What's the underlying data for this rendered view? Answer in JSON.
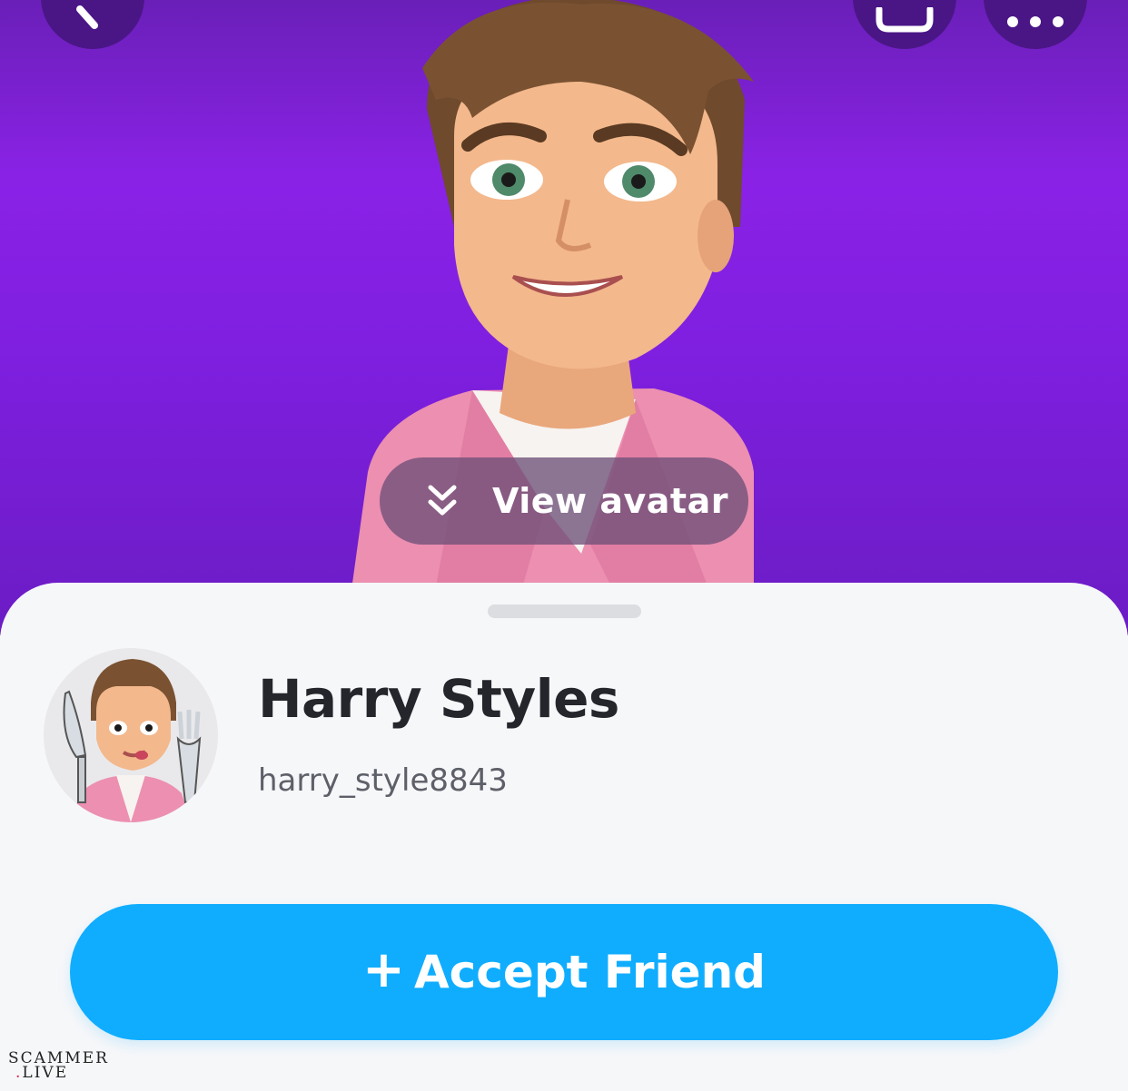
{
  "hero": {
    "view_avatar_label": "View avatar"
  },
  "profile": {
    "display_name": "Harry Styles",
    "username": "harry_style8843"
  },
  "actions": {
    "accept_label": "Accept Friend",
    "accept_prefix": "+"
  },
  "watermark": {
    "line1": "SCAMMER",
    "line2": "LIVE",
    "dot": "."
  },
  "colors": {
    "hero_purple": "#8a22e6",
    "accept_blue": "#10adff",
    "name_text": "#24262b",
    "username_text": "#5d6068"
  },
  "icons": {
    "back": "chevron-left-icon",
    "story": "story-icon",
    "more": "more-dots-icon",
    "view_avatar": "double-chevron-down-icon"
  }
}
